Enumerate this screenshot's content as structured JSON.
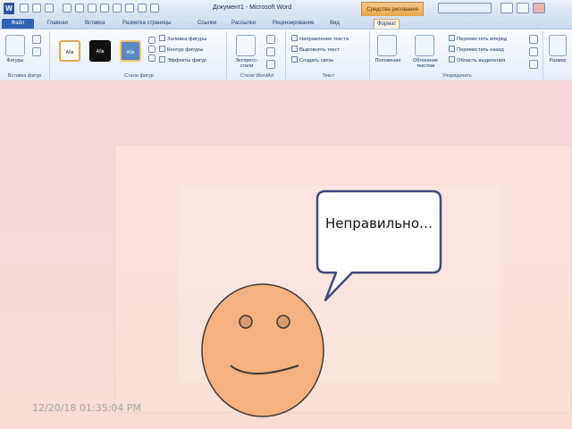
{
  "word": {
    "title": "Документ1 - Microsoft Word",
    "context_title": "Средства рисования",
    "tabs": [
      {
        "label": "Файл"
      },
      {
        "label": "Главная"
      },
      {
        "label": "Вставка"
      },
      {
        "label": "Разметка страницы"
      },
      {
        "label": "Ссылки"
      },
      {
        "label": "Рассылки"
      },
      {
        "label": "Рецензирование"
      },
      {
        "label": "Вид"
      },
      {
        "label": "Формат"
      }
    ],
    "groups": {
      "insert_shapes": {
        "label": "Вставка фигур",
        "button": "Фигуры"
      },
      "shape_styles": {
        "label": "Стили фигур",
        "swatch_text": "Абв",
        "commands": [
          "Заливка фигуры",
          "Контур фигуры",
          "Эффекты фигур"
        ]
      },
      "wordart": {
        "label": "Стили WordArt",
        "button": "Экспресс-стили"
      },
      "text": {
        "label": "Текст",
        "commands": [
          "Направление текста",
          "Выровнять текст",
          "Создать связь"
        ]
      },
      "arrange": {
        "label": "Упорядочить",
        "buttons": [
          "Положение",
          "Обтекание текстом"
        ],
        "commands": [
          "Переместить вперед",
          "Переместить назад",
          "Область выделения"
        ]
      },
      "size": {
        "button": "Размер"
      }
    }
  },
  "bubble": {
    "text": "Неправильно…"
  },
  "timestamp": "12/20/18 01:35:04 PM",
  "colors": {
    "bubble_border": "#3e4a7a",
    "face_fill": "#f8b27f",
    "face_stroke": "#3a3a3a",
    "eye_fill": "#d99b6d"
  }
}
